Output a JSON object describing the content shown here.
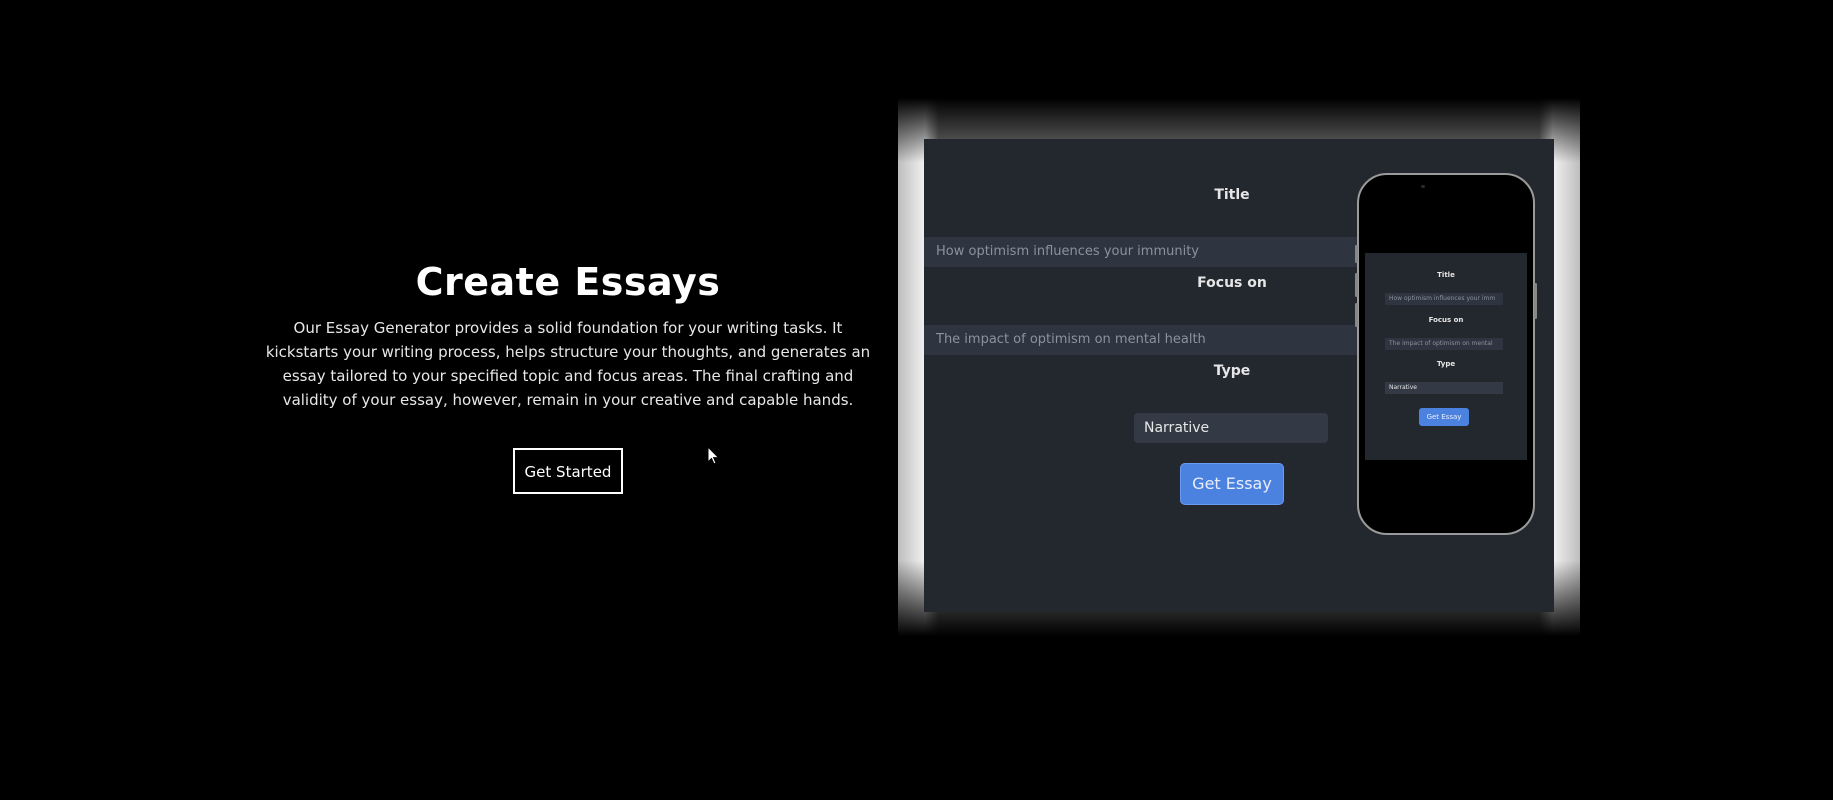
{
  "hero": {
    "title": "Create Essays",
    "description": "Our Essay Generator provides a solid foundation for your writing tasks. It kickstarts your writing process, helps structure your thoughts, and generates an essay tailored to your specified topic and focus areas. The final crafting and validity of your essay, however, remain in your creative and capable hands.",
    "cta_label": "Get Started"
  },
  "preview": {
    "title_label": "Title",
    "title_value": "How optimism influences your immunity",
    "focus_label": "Focus on",
    "focus_value": "The impact of optimism on mental health",
    "type_label": "Type",
    "type_value": "Narrative",
    "button_label": "Get Essay"
  },
  "phone_preview": {
    "title_label": "Title",
    "title_value": "How optimism influences your imm",
    "focus_label": "Focus on",
    "focus_value": "The impact of optimism on mental",
    "type_label": "Type",
    "type_value": "Narrative",
    "button_label": "Get Essay"
  },
  "colors": {
    "background": "#000000",
    "screen_bg": "#23272e",
    "input_bg": "#2f3540",
    "accent_button": "#4b82e0"
  }
}
